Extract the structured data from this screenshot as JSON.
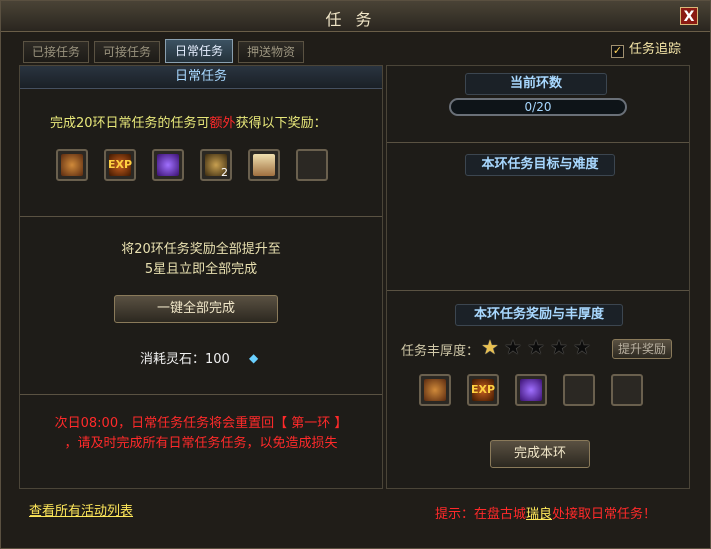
{
  "window": {
    "title": "任务",
    "close_symbol": "X"
  },
  "tabs": [
    {
      "label": "已接任务",
      "active": false
    },
    {
      "label": "可接任务",
      "active": false
    },
    {
      "label": "日常任务",
      "active": true
    },
    {
      "label": "押送物资",
      "active": false
    }
  ],
  "tracking": {
    "label": "任务追踪",
    "checked": true,
    "check_mark": "✓"
  },
  "left": {
    "header": "日常任务",
    "intro_before": "完成20环日常任务的任务可",
    "intro_extra": "额外",
    "intro_after": "获得以下奖励：",
    "rewards": [
      {
        "icon": "chest-icon",
        "count": ""
      },
      {
        "icon": "exp-icon",
        "text": "EXP",
        "count": ""
      },
      {
        "icon": "shadow-figure-icon",
        "count": ""
      },
      {
        "icon": "potion-icon",
        "count": "2"
      },
      {
        "icon": "scroll-icon",
        "count": ""
      },
      {
        "icon": "empty-slot",
        "count": ""
      }
    ],
    "upgrade_line1": "将20环任务奖励全部提升至",
    "upgrade_line2": "5星且立即全部完成",
    "complete_all_button": "一键全部完成",
    "cost_label": "消耗灵石：100",
    "reset_line1": "次日08:00，日常任务任务将会重置回【 第一环 】",
    "reset_line2": "，请及时完成所有日常任务任务，以免造成损失"
  },
  "right": {
    "current_round_label": "当前环数",
    "progress_text": "0/20",
    "progress_value": 0,
    "goal_label": "本环任务目标与难度",
    "reward_label": "本环任务奖励与丰厚度",
    "richness_label": "任务丰厚度：",
    "stars_total": 5,
    "stars_filled": 1,
    "upgrade_reward_button": "提升奖励",
    "round_rewards": [
      {
        "icon": "chest-icon"
      },
      {
        "icon": "exp-icon",
        "text": "EXP"
      },
      {
        "icon": "shadow-figure-icon"
      },
      {
        "icon": "empty-slot"
      },
      {
        "icon": "empty-slot"
      }
    ],
    "complete_round_button": "完成本环"
  },
  "footer": {
    "activity_link": "查看所有活动列表",
    "tip_before": "提示：在盘古城",
    "tip_npc": "瑞良",
    "tip_after": "处接取日常任务！"
  },
  "colors": {
    "accent_green": "#e8e87a",
    "warning_red": "#ff2a2a",
    "header_blue": "#a8d8ff",
    "link_yellow": "#ffe85a"
  }
}
